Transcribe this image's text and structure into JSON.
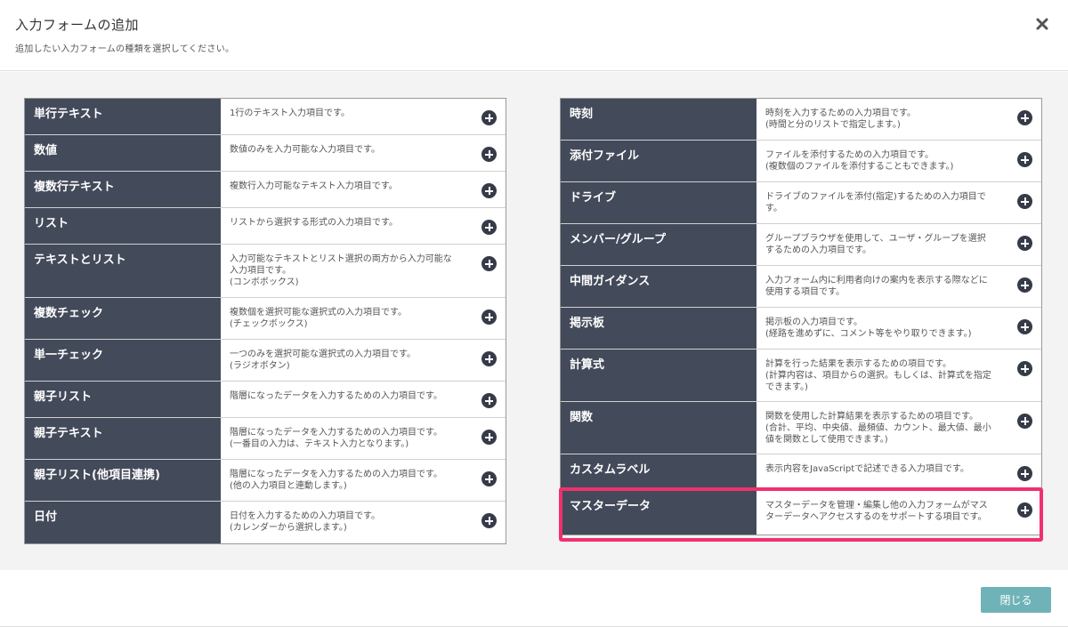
{
  "header": {
    "title": "入力フォームの追加",
    "subtitle": "追加したい入力フォームの種類を選択してください。"
  },
  "left": [
    {
      "name": "単行テキスト",
      "desc": "1行のテキスト入力項目です。"
    },
    {
      "name": "数値",
      "desc": "数値のみを入力可能な入力項目です。"
    },
    {
      "name": "複数行テキスト",
      "desc": "複数行入力可能なテキスト入力項目です。"
    },
    {
      "name": "リスト",
      "desc": "リストから選択する形式の入力項目です。"
    },
    {
      "name": "テキストとリスト",
      "desc": "入力可能なテキストとリスト選択の両方から入力可能な\n入力項目です。\n(コンボボックス)"
    },
    {
      "name": "複数チェック",
      "desc": "複数個を選択可能な選択式の入力項目です。\n(チェックボックス)"
    },
    {
      "name": "単一チェック",
      "desc": "一つのみを選択可能な選択式の入力項目です。\n(ラジオボタン)"
    },
    {
      "name": "親子リスト",
      "desc": "階層になったデータを入力するための入力項目です。"
    },
    {
      "name": "親子テキスト",
      "desc": "階層になったデータを入力するための入力項目です。\n(一番目の入力は、テキスト入力となります。)"
    },
    {
      "name": "親子リスト(他項目連携)",
      "desc": "階層になったデータを入力するための入力項目です。\n(他の入力項目と連動します。)"
    },
    {
      "name": "日付",
      "desc": "日付を入力するための入力項目です。\n(カレンダーから選択します。)"
    }
  ],
  "right": [
    {
      "name": "時刻",
      "desc": "時刻を入力するための入力項目です。\n(時間と分のリストで指定します。)"
    },
    {
      "name": "添付ファイル",
      "desc": "ファイルを添付するための入力項目です。\n(複数個のファイルを添付することもできます。)"
    },
    {
      "name": "ドライブ",
      "desc": "ドライブのファイルを添付(指定)するための入力項目で\nす。"
    },
    {
      "name": "メンバー/グループ",
      "desc": "グループブラウザを使用して、ユーザ・グループを選択\nするための入力項目です。"
    },
    {
      "name": "中間ガイダンス",
      "desc": "入力フォーム内に利用者向けの案内を表示する際などに\n使用する項目です。"
    },
    {
      "name": "掲示板",
      "desc": "掲示板の入力項目です。\n(経路を進めずに、コメント等をやり取りできます。)"
    },
    {
      "name": "計算式",
      "desc": "計算を行った結果を表示するための項目です。\n(計算内容は、項目からの選択。もしくは、計算式を指定\nできます。)"
    },
    {
      "name": "関数",
      "desc": "関数を使用した計算結果を表示するための項目です。\n(合計、平均、中央値、最頻値、カウント、最大値、最小\n値を関数として使用できます。)"
    },
    {
      "name": "カスタムラベル",
      "desc": "表示内容をJavaScriptで記述できる入力項目です。"
    },
    {
      "name": "マスターデータ",
      "desc": "マスターデータを管理・編集し他の入力フォームがマス\nターデータへアクセスするのをサポートする項目です。"
    }
  ],
  "footer": {
    "close_label": "閉じる"
  },
  "colors": {
    "name_bg": "#434a5a",
    "highlight": "#f0306e",
    "close_btn": "#6fb3b8"
  },
  "icons": {
    "close": "close-icon",
    "add": "plus-circle-icon"
  }
}
